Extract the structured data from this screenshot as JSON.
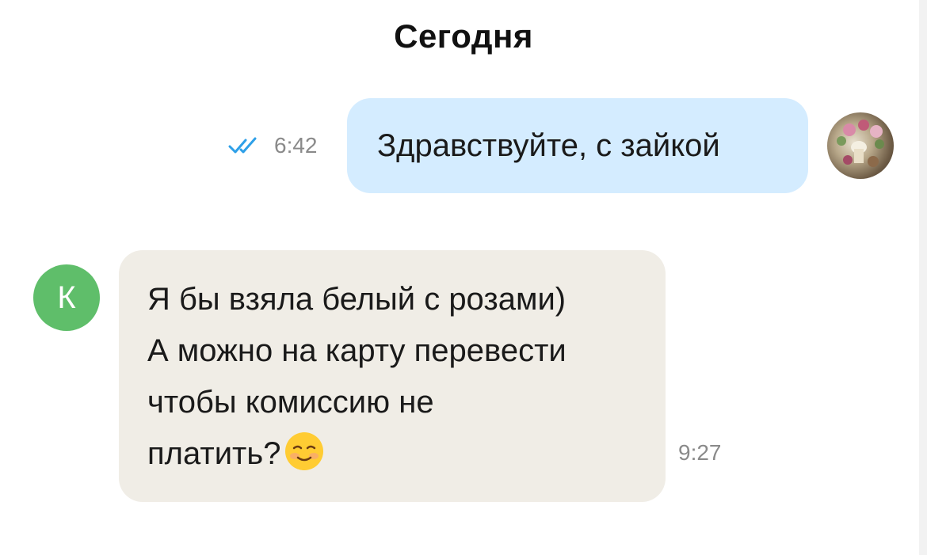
{
  "date_header": "Сегодня",
  "outgoing": {
    "text": "Здравствуйте, с зайкой",
    "time": "6:42",
    "status_icon": "double-check-icon",
    "status_color": "#2ea0e8",
    "bubble_color": "#d4ecff"
  },
  "incoming": {
    "avatar_letter": "К",
    "avatar_color": "#5fbe6a",
    "lines": [
      "Я бы взяла белый с розами)",
      "А можно на карту перевести",
      "чтобы комиссию не",
      "платить?"
    ],
    "emoji": "smiling-face-emoji",
    "time": "9:27",
    "bubble_color": "#f0ede6"
  }
}
